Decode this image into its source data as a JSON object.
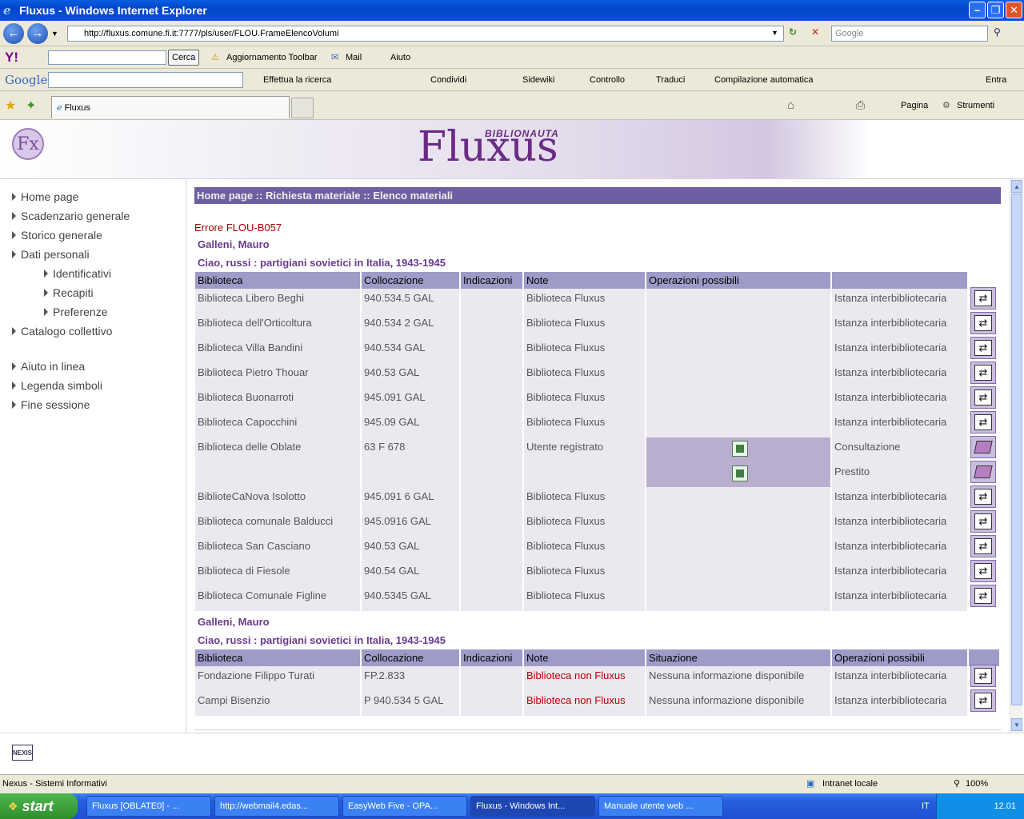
{
  "window": {
    "title": "Fluxus - Windows Internet Explorer"
  },
  "address_bar": {
    "url": "http://fluxus.comune.fi.it:7777/pls/user/FLOU.FrameElencoVolumi",
    "search_placeholder": "Google"
  },
  "yahoo_toolbar": {
    "logo": "Y!",
    "search_button": "Cerca",
    "update": "Aggiornamento Toolbar",
    "mail": "Mail",
    "help": "Aiuto"
  },
  "google_toolbar": {
    "logo": "Google",
    "search": "Effettua la ricerca",
    "share": "Condividi",
    "sidewiki": "Sidewiki",
    "check": "Controllo",
    "translate": "Traduci",
    "autofill": "Compilazione automatica",
    "signin": "Entra"
  },
  "tabs": [
    {
      "label": "Fluxus"
    }
  ],
  "command_bar": {
    "page": "Pagina",
    "tools": "Strumenti"
  },
  "site": {
    "logo": "Fx",
    "brand": "Fluxus",
    "brand_sub": "BIBLIONAUTA"
  },
  "sidebar": {
    "items": [
      {
        "label": "Home page"
      },
      {
        "label": "Scadenzario generale"
      },
      {
        "label": "Storico generale"
      },
      {
        "label": "Dati personali"
      },
      {
        "label": "Identificativi"
      },
      {
        "label": "Recapiti"
      },
      {
        "label": "Preferenze"
      },
      {
        "label": "Catalogo collettivo"
      },
      {
        "label": "Aiuto in linea"
      },
      {
        "label": "Legenda simboli"
      },
      {
        "label": "Fine sessione"
      }
    ]
  },
  "main": {
    "breadcrumb": "Home page :: Richiesta materiale :: Elenco materiali",
    "error": "Errore FLOU-B057",
    "section1": {
      "author": "Galleni, Mauro",
      "title": "Ciao, russi : partigiani sovietici in Italia, 1943-1945",
      "headers": [
        "Biblioteca",
        "Collocazione",
        "Indicazioni",
        "Note",
        "Operazioni possibili",
        ""
      ],
      "rows": [
        {
          "lib": "Biblioteca Libero Beghi",
          "coll": "940.534.5 GAL",
          "ind": "",
          "note": "Biblioteca Fluxus",
          "op": "Istanza interbibliotecaria"
        },
        {
          "lib": "Biblioteca dell'Orticoltura",
          "coll": "940.534 2 GAL",
          "ind": "",
          "note": "Biblioteca Fluxus",
          "op": "Istanza interbibliotecaria"
        },
        {
          "lib": "Biblioteca Villa Bandini",
          "coll": "940.534 GAL",
          "ind": "",
          "note": "Biblioteca Fluxus",
          "op": "Istanza interbibliotecaria"
        },
        {
          "lib": "Biblioteca Pietro Thouar",
          "coll": "940.53 GAL",
          "ind": "",
          "note": "Biblioteca Fluxus",
          "op": "Istanza interbibliotecaria"
        },
        {
          "lib": "Biblioteca Buonarroti",
          "coll": "945.091 GAL",
          "ind": "",
          "note": "Biblioteca Fluxus",
          "op": "Istanza interbibliotecaria"
        },
        {
          "lib": "Biblioteca Capocchini",
          "coll": "945.09 GAL",
          "ind": "",
          "note": "Biblioteca Fluxus",
          "op": "Istanza interbibliotecaria"
        },
        {
          "lib": "Biblioteca delle Oblate",
          "coll": "63 F 678",
          "ind": "",
          "note": "Utente registrato",
          "op": "Consultazione",
          "check": true,
          "book": true
        },
        {
          "lib": "",
          "coll": "",
          "ind": "",
          "note": "",
          "op": "Prestito",
          "check": true,
          "book": true
        },
        {
          "lib": "BiblioteCaNova Isolotto",
          "coll": "945.091 6 GAL",
          "ind": "",
          "note": "Biblioteca Fluxus",
          "op": "Istanza interbibliotecaria"
        },
        {
          "lib": "Biblioteca comunale Balducci",
          "coll": "945.0916 GAL",
          "ind": "",
          "note": "Biblioteca Fluxus",
          "op": "Istanza interbibliotecaria"
        },
        {
          "lib": "Biblioteca San Casciano",
          "coll": "940.53 GAL",
          "ind": "",
          "note": "Biblioteca Fluxus",
          "op": "Istanza interbibliotecaria"
        },
        {
          "lib": "Biblioteca di Fiesole",
          "coll": "940.54 GAL",
          "ind": "",
          "note": "Biblioteca Fluxus",
          "op": "Istanza interbibliotecaria"
        },
        {
          "lib": "Biblioteca Comunale Figline",
          "coll": "940.5345 GAL",
          "ind": "",
          "note": "Biblioteca Fluxus",
          "op": "Istanza interbibliotecaria"
        }
      ]
    },
    "section2": {
      "author": "Galleni, Mauro",
      "title": "Ciao, russi : partigiani sovietici in Italia, 1943-1945",
      "headers": [
        "Biblioteca",
        "Collocazione",
        "Indicazioni",
        "Note",
        "Situazione",
        "Operazioni possibili"
      ],
      "rows": [
        {
          "lib": "Fondazione Filippo Turati",
          "coll": "FP.2.833",
          "ind": "",
          "note": "Biblioteca non Fluxus",
          "sit": "Nessuna informazione disponibile",
          "op": "Istanza interbibliotecaria"
        },
        {
          "lib": "Campi Bisenzio",
          "coll": "P 940.534 5 GAL",
          "ind": "",
          "note": "Biblioteca non Fluxus",
          "sit": "Nessuna informazione disponibile",
          "op": "Istanza interbibliotecaria"
        }
      ]
    }
  },
  "footer": {
    "logo": "NEXIS"
  },
  "statusbar": {
    "left": "Nexus - Sistemi Informativi",
    "zone": "Intranet locale",
    "zoom": "100%"
  },
  "taskbar": {
    "start": "start",
    "tasks": [
      "Fluxus [OBLATE0] - ...",
      "http://webmail4.edas...",
      "EasyWeb Five - OPA...",
      "Fluxus - Windows Int...",
      "Manuale utente web ..."
    ],
    "lang": "IT",
    "clock": "12.01"
  }
}
